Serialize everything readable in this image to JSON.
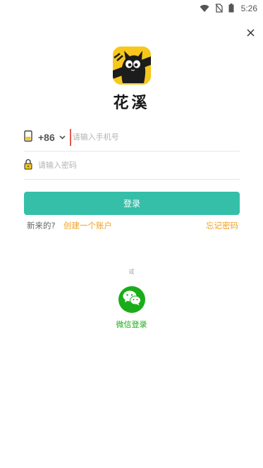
{
  "status_bar": {
    "time": "5:26",
    "icons": [
      "wifi-icon",
      "no-sim-icon",
      "battery-icon"
    ]
  },
  "header": {
    "close_icon": "close-icon"
  },
  "brand": {
    "logo_icon": "cat-app-logo",
    "name": "花溪"
  },
  "login_form": {
    "phone": {
      "country_code": "+86",
      "placeholder": "请输入手机号",
      "icon": "phone-icon"
    },
    "password": {
      "placeholder": "请输入密码",
      "icon": "lock-icon"
    },
    "submit_label": "登录"
  },
  "links": {
    "new_user_label": "新来的?",
    "create_account": "创建一个账户",
    "forgot_password": "忘记密码"
  },
  "alt_login": {
    "divider": "或",
    "wechat_label": "微信登录",
    "wechat_icon": "wechat-icon"
  },
  "colors": {
    "accent": "#35bfa8",
    "link": "#f0a023",
    "wechat": "#1aad19"
  }
}
